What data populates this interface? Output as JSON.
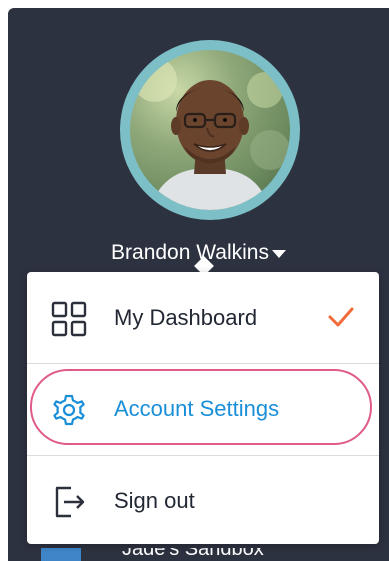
{
  "user": {
    "name": "Brandon Walkins"
  },
  "menu": {
    "items": [
      {
        "label": "My Dashboard",
        "icon": "dashboard-grid-icon",
        "selected": true
      },
      {
        "label": "Account Settings",
        "icon": "gear-icon",
        "highlighted": true
      },
      {
        "label": "Sign out",
        "icon": "sign-out-icon"
      }
    ]
  },
  "background": {
    "workspace_label": "Jade's Sandbox"
  },
  "colors": {
    "panel_bg": "#2d3240",
    "avatar_ring": "#7dbfc6",
    "accent_blue": "#1a8fd8",
    "check_orange": "#f26b3a",
    "highlight_pink": "#e05a8a"
  }
}
